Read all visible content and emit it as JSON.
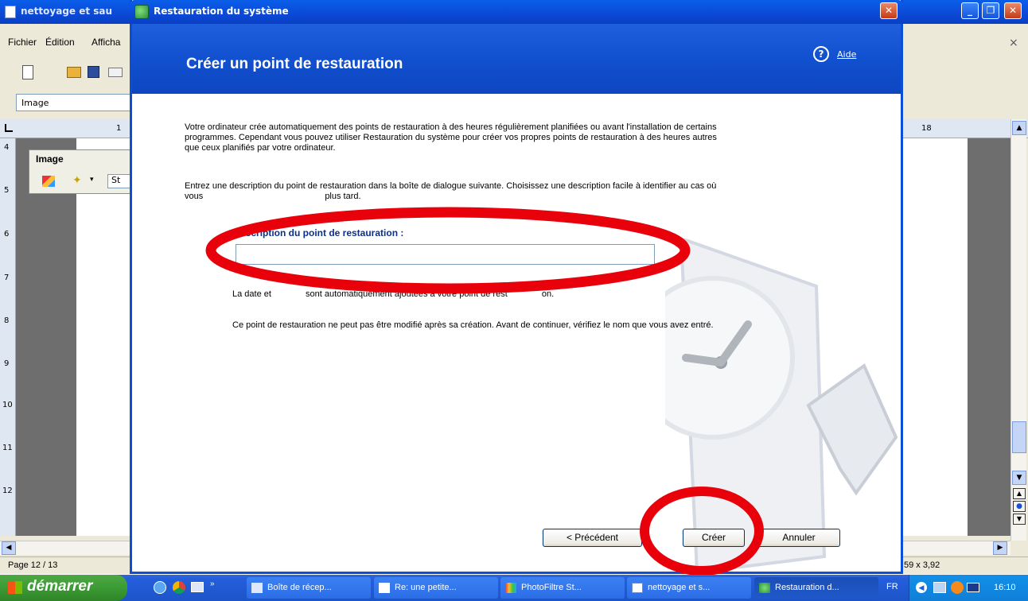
{
  "background_window": {
    "title": "nettoyage et sau",
    "menu": [
      "Fichier",
      "Édition",
      "Afficha"
    ],
    "style_box": "Image",
    "image_panel_title": "Image",
    "image_panel_field": "St",
    "ruler_top_left": "1",
    "ruler_top_right": "18",
    "ruler_left": [
      "4",
      "5",
      "6",
      "7",
      "8",
      "9",
      "10",
      "11",
      "12"
    ],
    "status_left": "Page 12 / 13",
    "status_right": "59 x 3,92"
  },
  "dialog": {
    "title": "Restauration du système",
    "heading": "Créer un point de restauration",
    "help_label": "Aide",
    "para1": "Votre ordinateur crée automatiquement des points de restauration à des heures régulièrement planifiées ou avant l'installation de certains programmes. Cependant vous pouvez utiliser Restauration du système pour créer vos propres points de restauration à des heures autres que ceux planifiés par votre ordinateur.",
    "para2_visible": "Entrez une description du point de restauration dans la boîte de dialogue suivante. Choisissez une description facile à identifier au cas où vous",
    "para2_tail": "plus tard.",
    "field_label": "escription du point de restauration :",
    "field_value": "",
    "note_start": "La date et",
    "note_middle": "sont automatiquement ajoutées à votre point de rest",
    "note_end": "on.",
    "para4": "Ce point de restauration ne peut pas être modifié après sa création. Avant de continuer, vérifiez le nom que vous avez entré.",
    "buttons": {
      "prev": "< Précédent",
      "create": "Créer",
      "cancel": "Annuler"
    }
  },
  "taskbar": {
    "start": "démarrer",
    "items": [
      "Boîte de récep...",
      "Re: une petite...",
      "PhotoFiltre St...",
      "nettoyage et s...",
      "Restauration d..."
    ],
    "lang": "FR",
    "clock": "16:10"
  },
  "colors": {
    "xp_blue": "#0a4fd6",
    "taskbar": "#245edb",
    "start_green": "#3c9b34",
    "annotation_red": "#e8000b"
  }
}
